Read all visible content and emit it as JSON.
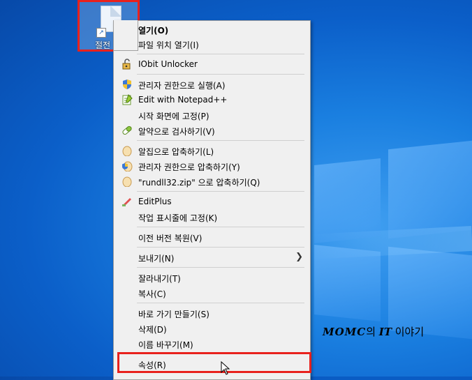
{
  "desktop": {
    "icon_label": "절전",
    "watermark": {
      "brand": "MOMC",
      "mid": "의 ",
      "it": "IT",
      "tail": " 이야기"
    }
  },
  "menu": {
    "items": [
      {
        "label": "열기(O)",
        "icon": "none",
        "bold": true
      },
      {
        "label": "파일 위치 열기(I)",
        "icon": "none"
      },
      {
        "label": "IObit Unlocker",
        "icon": "unlock-icon"
      },
      {
        "label": "관리자 권한으로 실행(A)",
        "icon": "shield-icon"
      },
      {
        "label": "Edit with Notepad++",
        "icon": "notepad-icon"
      },
      {
        "label": "시작 화면에 고정(P)",
        "icon": "none"
      },
      {
        "label": "알약으로 검사하기(V)",
        "icon": "pill-icon"
      },
      {
        "label": "알집으로 압축하기(L)",
        "icon": "alzip-icon"
      },
      {
        "label": "관리자 권한으로 압축하기(Y)",
        "icon": "alzip-shield-icon"
      },
      {
        "label": "\"rundll32.zip\" 으로 압축하기(Q)",
        "icon": "alzip-icon"
      },
      {
        "label": "EditPlus",
        "icon": "editplus-icon"
      },
      {
        "label": "작업 표시줄에 고정(K)",
        "icon": "none"
      },
      {
        "label": "이전 버전 복원(V)",
        "icon": "none"
      },
      {
        "label": "보내기(N)",
        "icon": "none",
        "submenu": true
      },
      {
        "label": "잘라내기(T)",
        "icon": "none"
      },
      {
        "label": "복사(C)",
        "icon": "none"
      },
      {
        "label": "바로 가기 만들기(S)",
        "icon": "none"
      },
      {
        "label": "삭제(D)",
        "icon": "none"
      },
      {
        "label": "이름 바꾸기(M)",
        "icon": "none"
      },
      {
        "label": "속성(R)",
        "icon": "none"
      }
    ]
  },
  "colors": {
    "highlight_box": "#e8211d",
    "menu_bg": "#f0f0f0"
  }
}
